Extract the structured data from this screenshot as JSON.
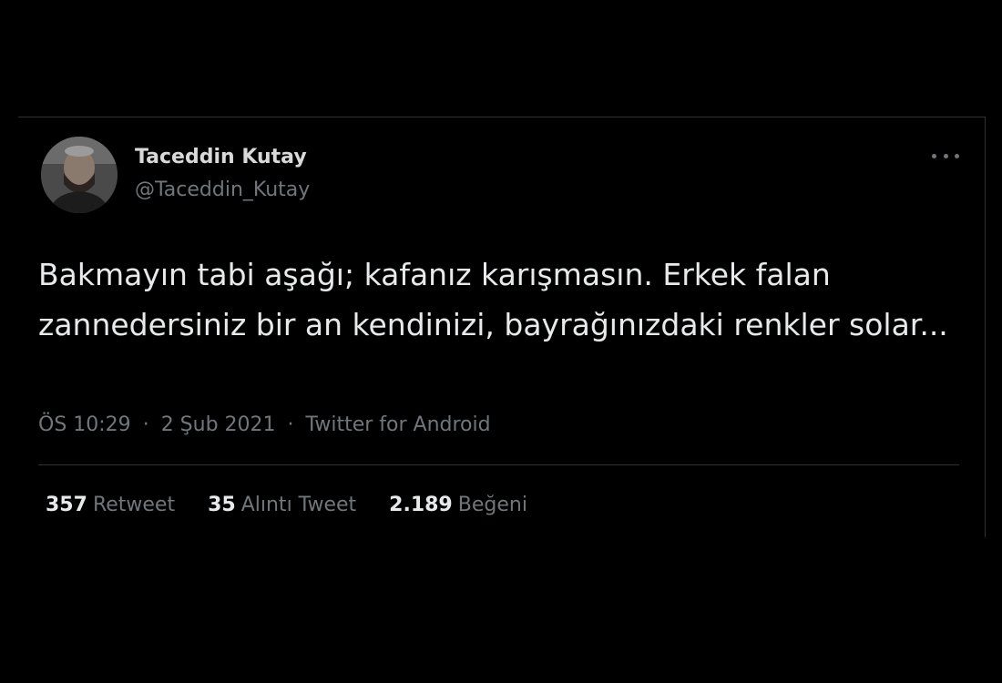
{
  "tweet": {
    "author_name": "Taceddin Kutay",
    "author_handle": "@Taceddin_Kutay",
    "text": "Bakmayın tabi aşağı; kafanız karışmasın. Erkek falan zannedersiniz bir an kendinizi, bayrağınızdaki renkler solar...",
    "time": "ÖS 10:29",
    "date": "2 Şub 2021",
    "separator": "·",
    "source": "Twitter for Android",
    "more_icon": "more-horizontal-icon"
  },
  "stats": {
    "retweets_count": "357",
    "retweets_label": "Retweet",
    "quotes_count": "35",
    "quotes_label": "Alıntı Tweet",
    "likes_count": "2.189",
    "likes_label": "Beğeni"
  },
  "colors": {
    "background": "#000000",
    "primary_text": "#e7e9ea",
    "secondary_text": "#71767b",
    "border": "#2f3336"
  }
}
